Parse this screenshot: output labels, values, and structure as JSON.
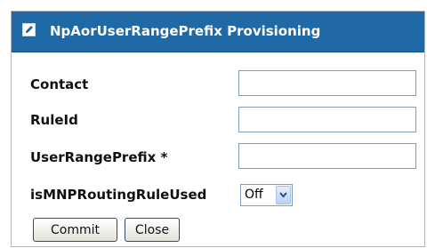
{
  "dialog": {
    "title": "NpAorUserRangePrefix  Provisioning",
    "title_icon": "edit-icon"
  },
  "form": {
    "fields": [
      {
        "label": "Contact",
        "value": ""
      },
      {
        "label": "RuleId",
        "value": ""
      },
      {
        "label": "UserRangePrefix *",
        "value": ""
      },
      {
        "label": "isMNPRoutingRuleUsed",
        "value": "Off",
        "options_visible": [
          "Off"
        ]
      }
    ]
  },
  "buttons": {
    "commit": "Commit",
    "close": "Close"
  },
  "colors": {
    "titlebar": "#1f69a7",
    "title_text": "#ffffff",
    "input_border": "#7f9db9"
  }
}
